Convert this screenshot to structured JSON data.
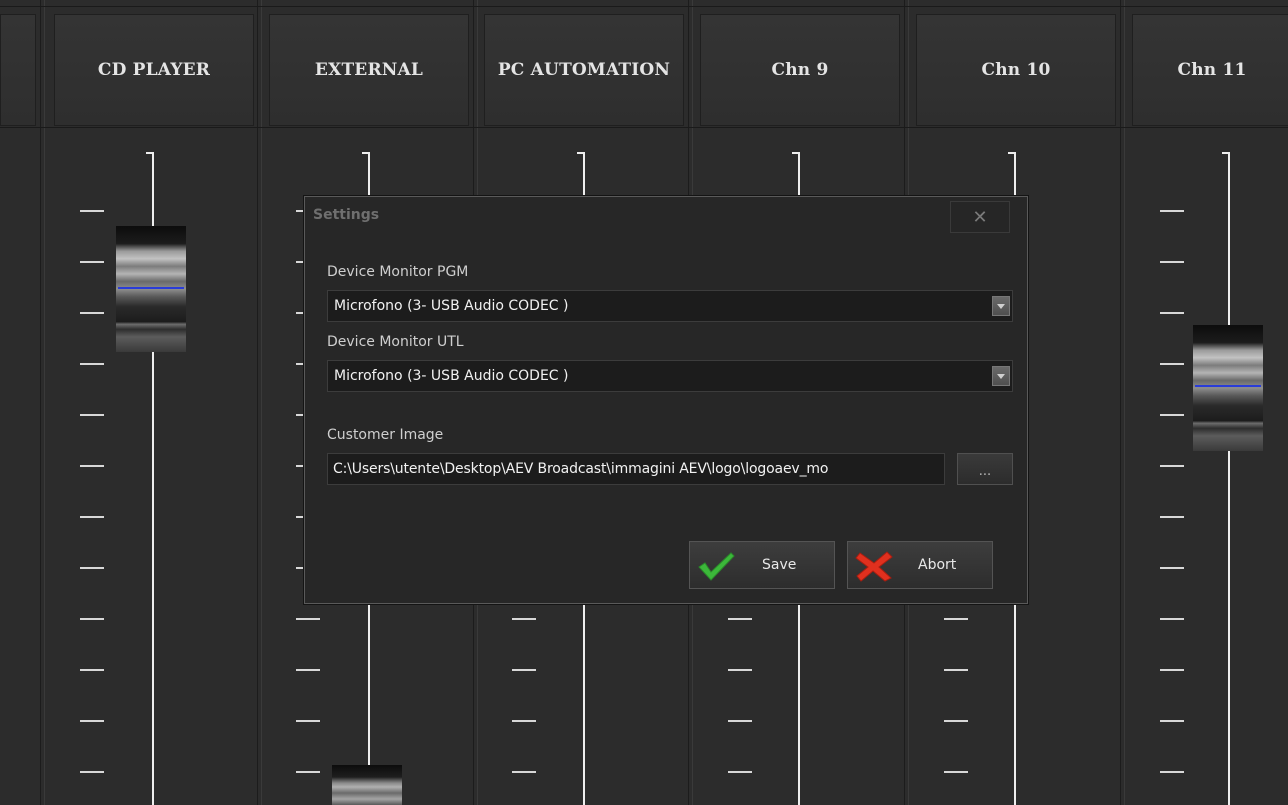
{
  "mixer": {
    "channels": [
      {
        "name": "CD PLAYER"
      },
      {
        "name": "EXTERNAL"
      },
      {
        "name": "PC AUTOMATION"
      },
      {
        "name": "Chn 9"
      },
      {
        "name": "Chn 10"
      },
      {
        "name": "Chn 11"
      }
    ]
  },
  "dialog": {
    "title": "Settings",
    "close_label": "✕",
    "pgm_label": "Device Monitor PGM",
    "pgm_value": "Microfono (3- USB Audio CODEC )",
    "utl_label": "Device Monitor UTL",
    "utl_value": "Microfono (3- USB Audio CODEC )",
    "image_label": "Customer Image",
    "image_path": "C:\\Users\\utente\\Desktop\\AEV Broadcast\\immagini AEV\\logo\\logoaev_mo",
    "browse_label": "...",
    "save_label": "Save",
    "abort_label": "Abort"
  },
  "colors": {
    "background": "#2b2b2b",
    "fader_indicator": "#2a3cd8",
    "save_icon": "#3cb83a",
    "abort_icon": "#e0301e"
  },
  "icons": {
    "save": "checkmark-icon",
    "abort": "red-x-icon"
  }
}
